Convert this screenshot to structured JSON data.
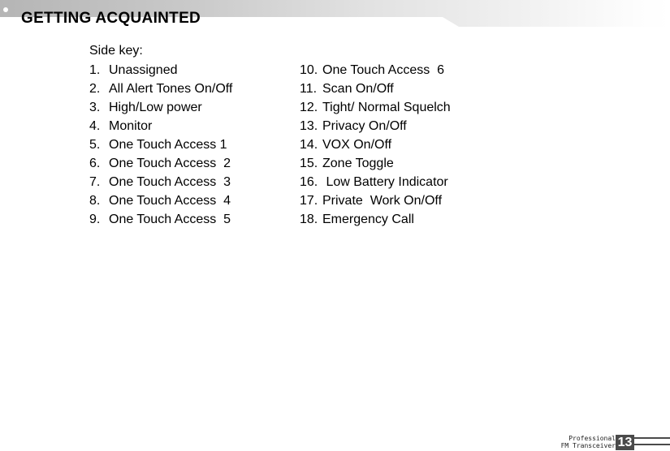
{
  "header": {
    "title": "GETTING ACQUAINTED",
    "bullet_icon": "bullet-dot-icon",
    "band_color_left": "#b8b8b8",
    "band_color_right": "#ffffff"
  },
  "content": {
    "section_label": "Side key:",
    "left_column": [
      {
        "num": "1.",
        "text": "Unassigned"
      },
      {
        "num": "2.",
        "text": "All Alert Tones On/Off"
      },
      {
        "num": "3.",
        "text": "High/Low power"
      },
      {
        "num": "4.",
        "text": "Monitor"
      },
      {
        "num": "5.",
        "text": "One Touch Access 1"
      },
      {
        "num": "6.",
        "text": "One Touch Access  2"
      },
      {
        "num": "7.",
        "text": "One Touch Access  3"
      },
      {
        "num": "8.",
        "text": "One Touch Access  4"
      },
      {
        "num": "9.",
        "text": "One Touch Access  5"
      }
    ],
    "right_column": [
      {
        "num": "10.",
        "text": "One Touch Access  6"
      },
      {
        "num": "11.",
        "text": "Scan On/Off"
      },
      {
        "num": "12.",
        "text": "Tight/ Normal Squelch"
      },
      {
        "num": "13.",
        "text": "Privacy On/Off"
      },
      {
        "num": "14.",
        "text": "VOX On/Off"
      },
      {
        "num": "15.",
        "text": "Zone Toggle"
      },
      {
        "num": "16.",
        "text": " Low Battery Indicator"
      },
      {
        "num": "17.",
        "text": "Private  Work On/Off"
      },
      {
        "num": "18.",
        "text": "Emergency Call"
      }
    ]
  },
  "footer": {
    "brand_line1": "Professional",
    "brand_line2": "FM Transceiver",
    "page_number": "13",
    "accent_color": "#4a4a4a"
  }
}
